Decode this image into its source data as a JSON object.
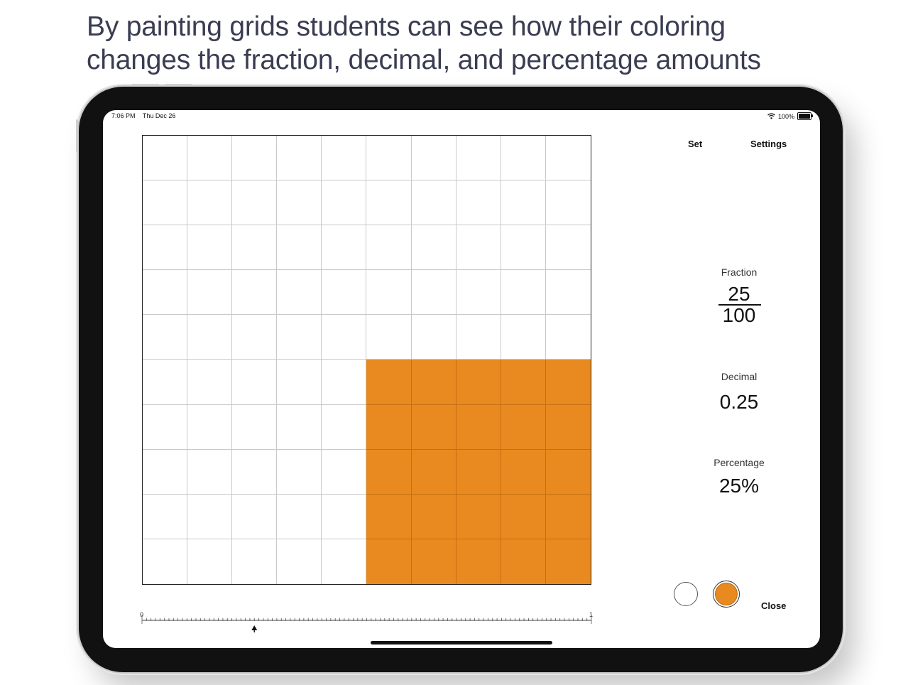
{
  "headline": {
    "line1": "By painting grids students can see how their coloring",
    "line2": "changes the fraction, decimal, and percentage amounts"
  },
  "status_bar": {
    "time": "7:06 PM",
    "date": "Thu Dec 26",
    "battery": "100%",
    "icons": [
      "wifi-icon",
      "battery-icon"
    ]
  },
  "toolbar": {
    "set_label": "Set",
    "settings_label": "Settings"
  },
  "grid": {
    "rows": 10,
    "cols": 10,
    "fill_color": "#e88a1f",
    "filled_row_range": [
      5,
      9
    ],
    "filled_col_range": [
      5,
      9
    ]
  },
  "fraction": {
    "label": "Fraction",
    "numerator": "25",
    "denominator": "100"
  },
  "decimal": {
    "label": "Decimal",
    "value": "0.25"
  },
  "percentage": {
    "label": "Percentage",
    "value": "25%"
  },
  "colors": {
    "white_swatch": "#ffffff",
    "orange_swatch": "#e88a1f",
    "selected": "orange"
  },
  "slider": {
    "min_label": "0",
    "max_label": "1",
    "value": 0.25
  },
  "close_label": "Close"
}
